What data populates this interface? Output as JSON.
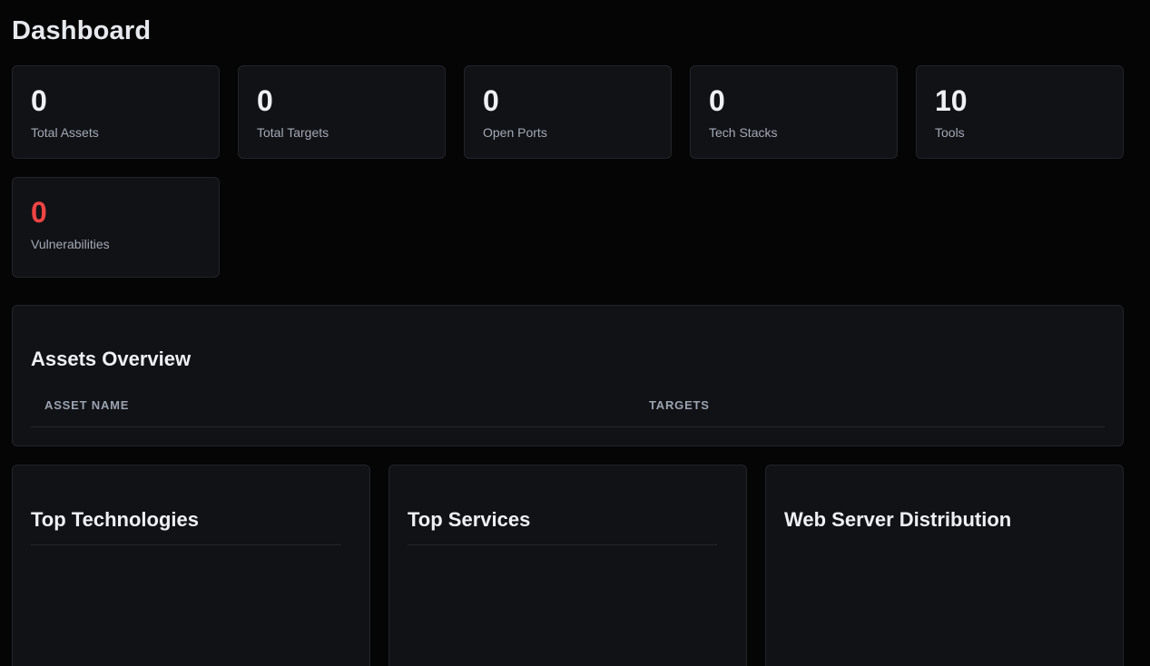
{
  "page": {
    "title": "Dashboard"
  },
  "stats": [
    {
      "value": "0",
      "label": "Total Assets"
    },
    {
      "value": "0",
      "label": "Total Targets"
    },
    {
      "value": "0",
      "label": "Open Ports"
    },
    {
      "value": "0",
      "label": "Tech Stacks"
    },
    {
      "value": "10",
      "label": "Tools"
    },
    {
      "value": "0",
      "label": "Vulnerabilities",
      "color": "#ef4444"
    }
  ],
  "assets_overview": {
    "title": "Assets Overview",
    "columns": [
      "ASSET NAME",
      "TARGETS"
    ],
    "rows": []
  },
  "panels": [
    {
      "title": "Top Technologies"
    },
    {
      "title": "Top Services"
    },
    {
      "title": "Web Server Distribution"
    }
  ],
  "colors": {
    "background": "#050505",
    "card": "#111216",
    "border": "#22242a",
    "danger": "#ef4444"
  }
}
